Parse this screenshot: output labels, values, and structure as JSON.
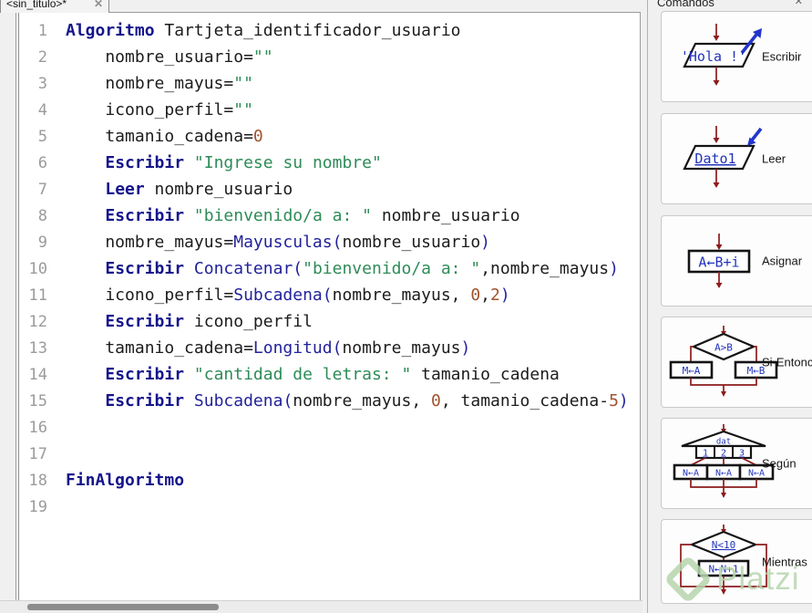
{
  "tab": {
    "title": "<sin_titulo>*",
    "close_icon": "✕"
  },
  "sidebar": {
    "title": "Comandos",
    "dock_icon": "✕",
    "buttons": [
      {
        "label": "Escribir",
        "shape_text": "'Hola !'"
      },
      {
        "label": "Leer",
        "shape_text": "Dato1"
      },
      {
        "label": "Asignar",
        "shape_text": "A←B+i"
      },
      {
        "label": "Si-Entonces",
        "cond": "A>B",
        "left_box": "M←A",
        "right_box": "M←B"
      },
      {
        "label": "Según",
        "roof": "dat",
        "cells": [
          "1",
          "2",
          "3"
        ],
        "box": "N←A"
      },
      {
        "label": "Mientras",
        "cond": "N<10",
        "body": "N←N+1"
      }
    ]
  },
  "watermark": {
    "text": "Platzi"
  },
  "colors": {
    "keyword": "#14148c",
    "function": "#22229b",
    "string": "#2e8b57",
    "number": "#a0522d",
    "flow_red": "#8b1c1c",
    "icon_blue": "#2233bb",
    "watermark_green": "#b7d6ae"
  },
  "editor": {
    "lines": [
      {
        "n": "1",
        "t": [
          [
            "kw",
            "Algoritmo"
          ],
          [
            "pl",
            " Tartjeta_identificador_usuario"
          ]
        ]
      },
      {
        "n": "2",
        "t": [
          [
            "pl",
            "    nombre_usuario="
          ],
          [
            "st",
            "\"\""
          ]
        ]
      },
      {
        "n": "3",
        "t": [
          [
            "pl",
            "    nombre_mayus="
          ],
          [
            "st",
            "\"\""
          ]
        ]
      },
      {
        "n": "4",
        "t": [
          [
            "pl",
            "    icono_perfil="
          ],
          [
            "st",
            "\"\""
          ]
        ]
      },
      {
        "n": "5",
        "t": [
          [
            "pl",
            "    tamanio_cadena="
          ],
          [
            "nu",
            "0"
          ]
        ]
      },
      {
        "n": "6",
        "t": [
          [
            "pl",
            "    "
          ],
          [
            "kw",
            "Escribir"
          ],
          [
            "pl",
            " "
          ],
          [
            "st",
            "\"Ingrese su nombre\""
          ]
        ]
      },
      {
        "n": "7",
        "t": [
          [
            "pl",
            "    "
          ],
          [
            "kw",
            "Leer"
          ],
          [
            "pl",
            " nombre_usuario"
          ]
        ]
      },
      {
        "n": "8",
        "t": [
          [
            "pl",
            "    "
          ],
          [
            "kw",
            "Escribir"
          ],
          [
            "pl",
            " "
          ],
          [
            "st",
            "\"bienvenido/a a: \""
          ],
          [
            "pl",
            " nombre_usuario"
          ]
        ]
      },
      {
        "n": "9",
        "t": [
          [
            "pl",
            "    nombre_mayus="
          ],
          [
            "fn",
            "Mayusculas("
          ],
          [
            "pl",
            "nombre_usuario"
          ],
          [
            "fn",
            ")"
          ]
        ]
      },
      {
        "n": "10",
        "t": [
          [
            "pl",
            "    "
          ],
          [
            "kw",
            "Escribir"
          ],
          [
            "pl",
            " "
          ],
          [
            "fn",
            "Concatenar("
          ],
          [
            "st",
            "\"bienvenido/a a: \""
          ],
          [
            "pl",
            ",nombre_mayus"
          ],
          [
            "fn",
            ")"
          ]
        ]
      },
      {
        "n": "11",
        "t": [
          [
            "pl",
            "    icono_perfil="
          ],
          [
            "fn",
            "Subcadena("
          ],
          [
            "pl",
            "nombre_mayus, "
          ],
          [
            "nu",
            "0"
          ],
          [
            "pl",
            ","
          ],
          [
            "nu",
            "2"
          ],
          [
            "fn",
            ")"
          ]
        ]
      },
      {
        "n": "12",
        "t": [
          [
            "pl",
            "    "
          ],
          [
            "kw",
            "Escribir"
          ],
          [
            "pl",
            " icono_perfil"
          ]
        ]
      },
      {
        "n": "13",
        "t": [
          [
            "pl",
            "    tamanio_cadena="
          ],
          [
            "fn",
            "Longitud("
          ],
          [
            "pl",
            "nombre_mayus"
          ],
          [
            "fn",
            ")"
          ]
        ]
      },
      {
        "n": "14",
        "t": [
          [
            "pl",
            "    "
          ],
          [
            "kw",
            "Escribir"
          ],
          [
            "pl",
            " "
          ],
          [
            "st",
            "\"cantidad de letras: \""
          ],
          [
            "pl",
            " tamanio_cadena"
          ]
        ]
      },
      {
        "n": "15",
        "t": [
          [
            "pl",
            "    "
          ],
          [
            "kw",
            "Escribir"
          ],
          [
            "pl",
            " "
          ],
          [
            "fn",
            "Subcadena("
          ],
          [
            "pl",
            "nombre_mayus, "
          ],
          [
            "nu",
            "0"
          ],
          [
            "pl",
            ", tamanio_cadena-"
          ],
          [
            "nu",
            "5"
          ],
          [
            "fn",
            ")"
          ]
        ]
      },
      {
        "n": "16",
        "t": []
      },
      {
        "n": "17",
        "t": []
      },
      {
        "n": "18",
        "t": [
          [
            "kw",
            "FinAlgoritmo"
          ]
        ]
      },
      {
        "n": "19",
        "t": []
      }
    ]
  }
}
